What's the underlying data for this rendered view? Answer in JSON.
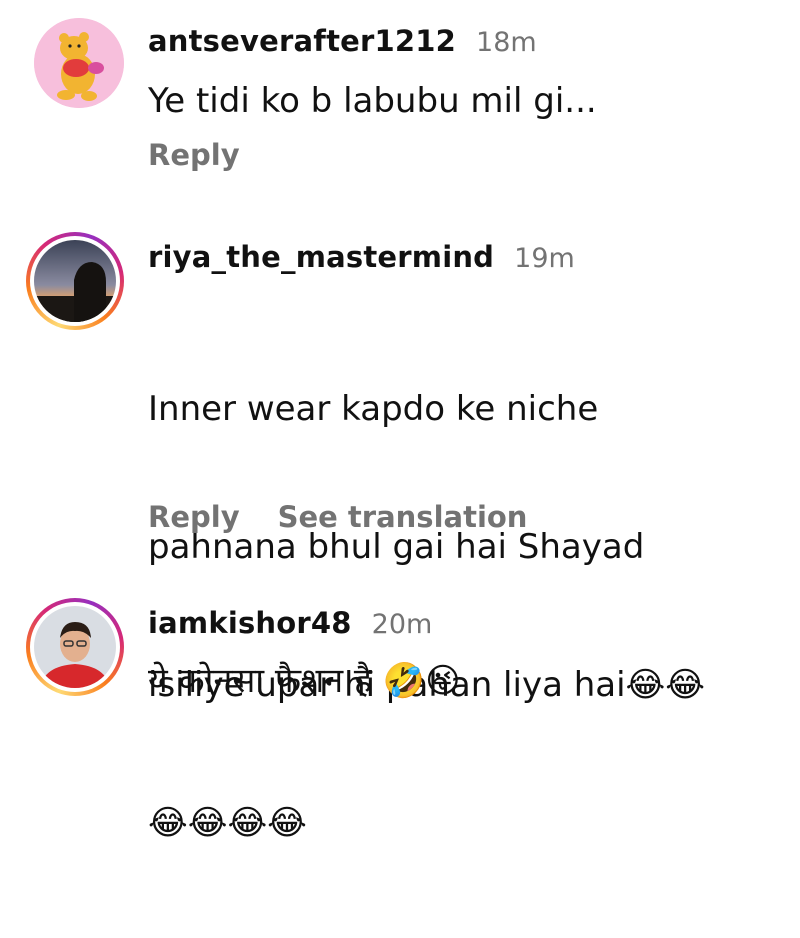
{
  "comments": [
    {
      "username": "antseverafter1212",
      "time": "18m",
      "text": "Ye tidi ko b labubu mil gi...",
      "actions": [
        "Reply"
      ]
    },
    {
      "username": "riya_the_mastermind",
      "time": "19m",
      "text_lines": [
        "Inner wear kapdo ke niche",
        "pahnana bhul gai hai Shayad",
        "isiliye upar hi pahan liya hai😂😂",
        "😂😂😂😂"
      ],
      "actions": [
        "Reply",
        "See translation"
      ]
    },
    {
      "username": "iamkishor48",
      "time": "20m",
      "text": "ये कोनसा फैशन है 🤣😜"
    }
  ]
}
